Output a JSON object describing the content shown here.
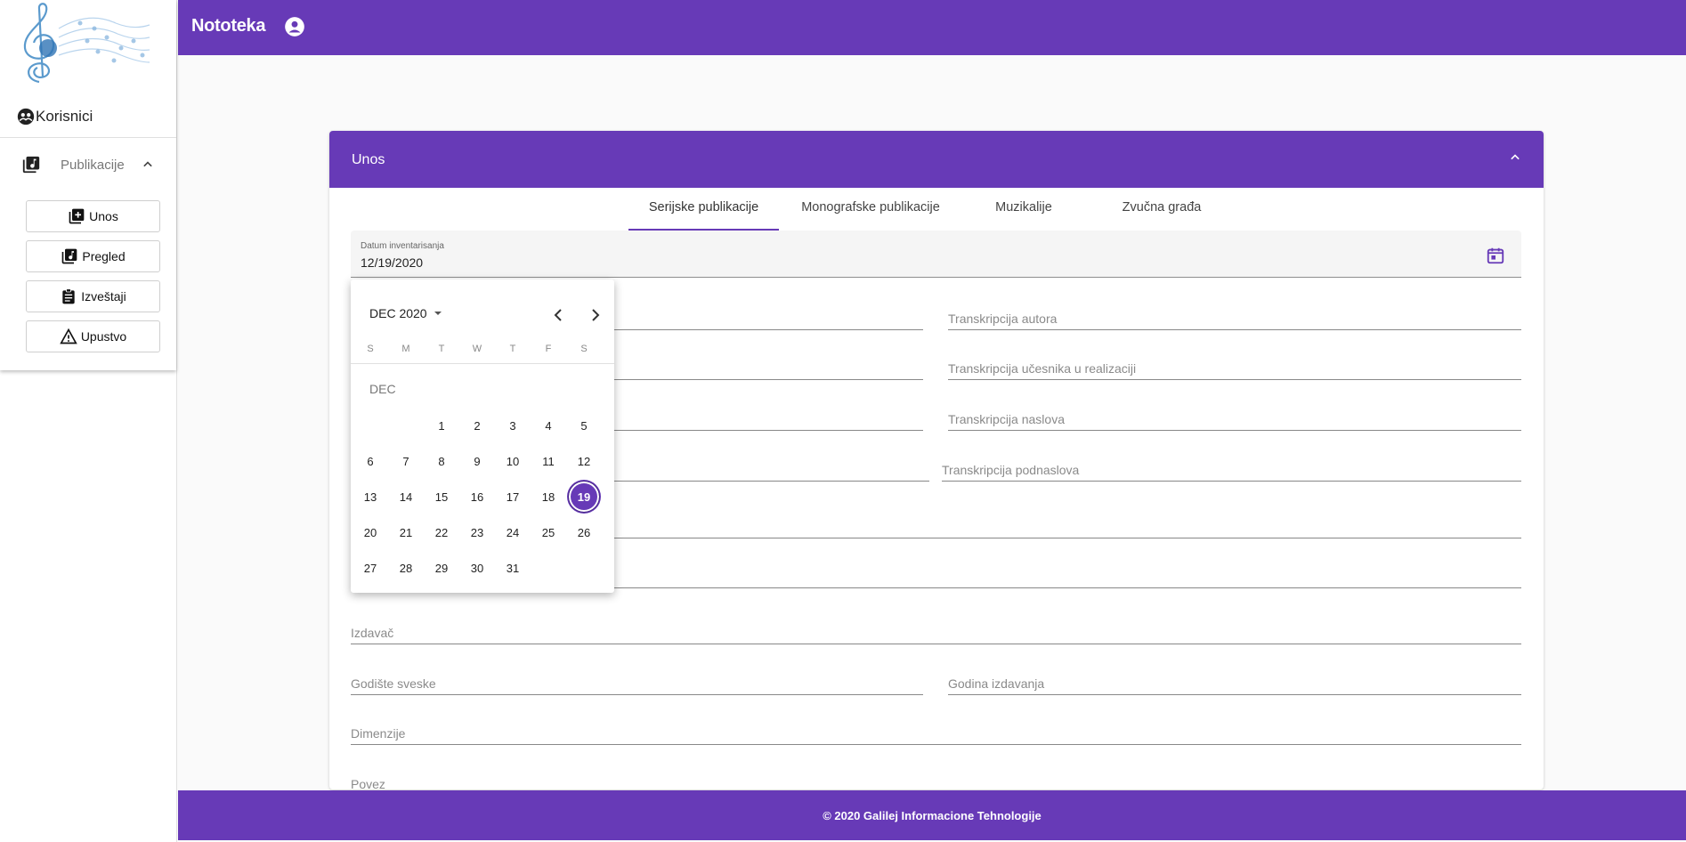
{
  "app": {
    "title": "Nototeka"
  },
  "sidebar": {
    "users_label": "Korisnici",
    "publications_label": "Publikacije",
    "items": [
      {
        "label": "Unos",
        "icon": "add-box-icon"
      },
      {
        "label": "Pregled",
        "icon": "library-music-icon"
      },
      {
        "label": "Izveštaji",
        "icon": "assignment-icon"
      },
      {
        "label": "Upustvo",
        "icon": "warning-icon"
      }
    ]
  },
  "panel": {
    "title": "Unos",
    "tabs": [
      {
        "label": "Serijske publikacije",
        "active": true
      },
      {
        "label": "Monografske publikacije",
        "active": false
      },
      {
        "label": "Muzikalije",
        "active": false
      },
      {
        "label": "Zvučna građa",
        "active": false
      }
    ],
    "date_field": {
      "label": "Datum inventarisanja",
      "value": "12/19/2020"
    },
    "fields": {
      "transkripcija_autora": "Transkripcija autora",
      "transkripcija_ucesnika": "Transkripcija učesnika u realizaciji",
      "transkripcija_naslova": "Transkripcija naslova",
      "transkripcija_podnaslova": "Transkripcija podnaslova",
      "izdavac": "Izdavač",
      "godiste_sveske": "Godište sveske",
      "godina_izdavanja": "Godina izdavanja",
      "dimenzije": "Dimenzije",
      "povez": "Povez"
    }
  },
  "datepicker": {
    "period_label": "DEC 2020",
    "weekdays": [
      "S",
      "M",
      "T",
      "W",
      "T",
      "F",
      "S"
    ],
    "month_label": "DEC",
    "selected_day": "19",
    "days": [
      "1",
      "2",
      "3",
      "4",
      "5",
      "6",
      "7",
      "8",
      "9",
      "10",
      "11",
      "12",
      "13",
      "14",
      "15",
      "16",
      "17",
      "18",
      "19",
      "20",
      "21",
      "22",
      "23",
      "24",
      "25",
      "26",
      "27",
      "28",
      "29",
      "30",
      "31"
    ]
  },
  "footer": {
    "text": "© 2020 Galilej Informacione Tehnologije"
  },
  "colors": {
    "primary": "#673ab7"
  }
}
